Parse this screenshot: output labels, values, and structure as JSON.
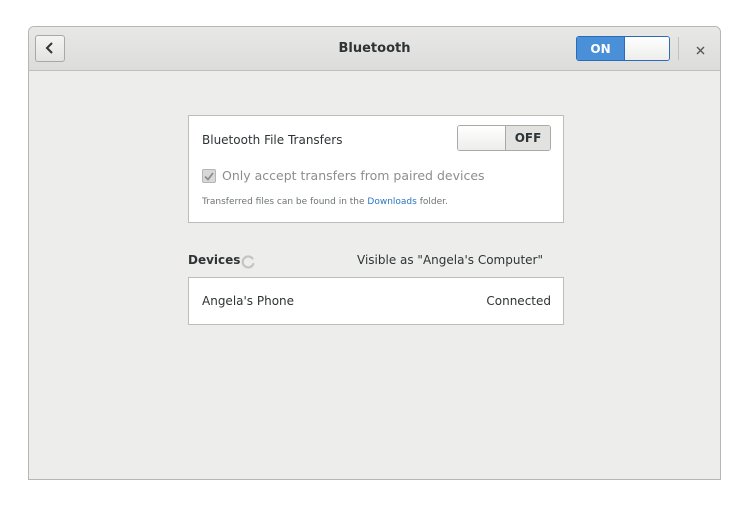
{
  "header": {
    "title": "Bluetooth",
    "power_switch": {
      "state_label": "ON",
      "state": true
    }
  },
  "file_transfers": {
    "label": "Bluetooth File Transfers",
    "switch": {
      "state_label": "OFF",
      "state": false
    },
    "paired_only": {
      "label": "Only accept transfers from paired devices",
      "checked": true,
      "enabled": false
    },
    "hint": {
      "prefix": "Transferred files can be found in the ",
      "link": "Downloads",
      "suffix": " folder."
    }
  },
  "devices": {
    "heading": "Devices",
    "visible_as": "Visible as \"Angela's Computer\"",
    "items": [
      {
        "name": "Angela's Phone",
        "status": "Connected"
      }
    ]
  },
  "icons": {
    "back": "chevron-left-icon",
    "close": "close-icon",
    "spinner": "spinner-icon",
    "check": "checkmark-icon"
  },
  "colors": {
    "accent": "#4a90d9",
    "link": "#2a76c6",
    "window_bg": "#ededeb"
  }
}
